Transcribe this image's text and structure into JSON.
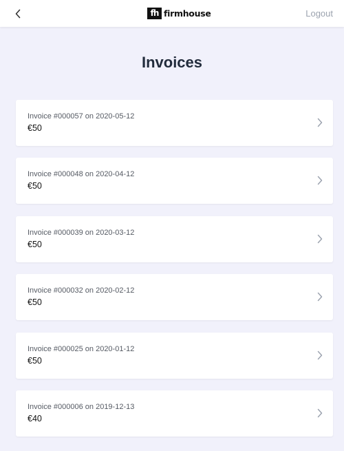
{
  "header": {
    "logo_text": "firmhouse",
    "logo_mark": "fh",
    "logout_label": "Logout"
  },
  "page": {
    "title": "Invoices"
  },
  "invoices": [
    {
      "description": "Invoice #000057 on 2020-05-12",
      "amount": "€50"
    },
    {
      "description": "Invoice #000048 on 2020-04-12",
      "amount": "€50"
    },
    {
      "description": "Invoice #000039 on 2020-03-12",
      "amount": "€50"
    },
    {
      "description": "Invoice #000032 on 2020-02-12",
      "amount": "€50"
    },
    {
      "description": "Invoice #000025 on 2020-01-12",
      "amount": "€50"
    },
    {
      "description": "Invoice #000006 on 2019-12-13",
      "amount": "€40"
    }
  ],
  "colors": {
    "background": "#f1f1fb",
    "header": "#ffffff",
    "title": "#222c3c",
    "muted": "#9ca3af"
  },
  "icons": {
    "back": "chevron-left-icon",
    "row": "chevron-right-icon"
  }
}
